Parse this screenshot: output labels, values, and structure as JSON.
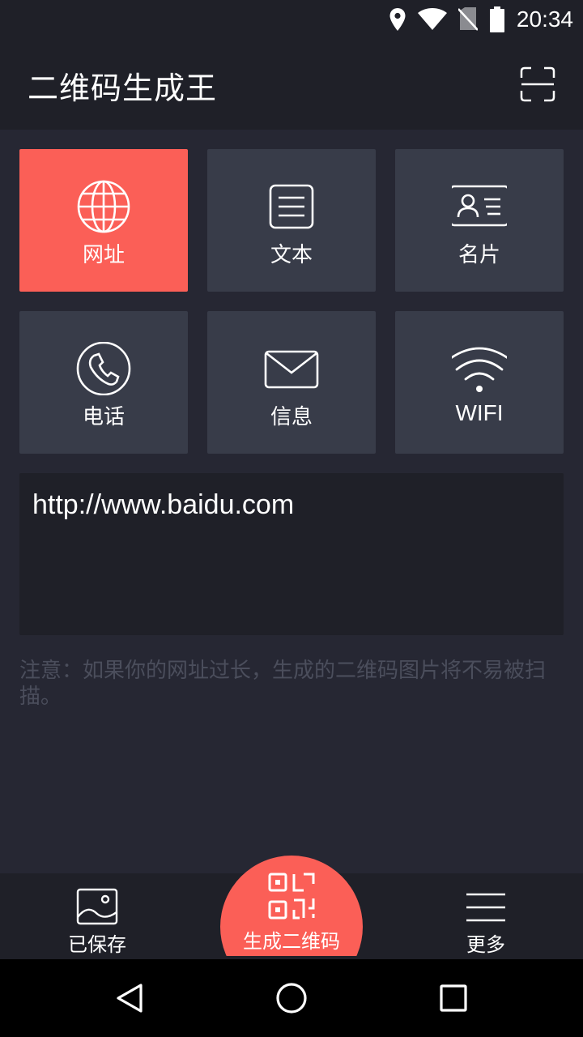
{
  "status": {
    "time": "20:34",
    "icons": [
      "location-icon",
      "wifi-icon",
      "no-sim-icon",
      "battery-icon"
    ]
  },
  "app": {
    "title": "二维码生成王",
    "scan_icon": "scan-icon"
  },
  "types": [
    {
      "label": "网址",
      "icon": "globe-icon",
      "active": true
    },
    {
      "label": "文本",
      "icon": "text-icon",
      "active": false
    },
    {
      "label": "名片",
      "icon": "contact-card-icon",
      "active": false
    },
    {
      "label": "电话",
      "icon": "phone-icon",
      "active": false
    },
    {
      "label": "信息",
      "icon": "mail-icon",
      "active": false
    },
    {
      "label": "WIFI",
      "icon": "wifi-icon",
      "active": false
    }
  ],
  "input": {
    "value": "http://www.baidu.com"
  },
  "note": "注意：如果你的网址过长，生成的二维码图片将不易被扫描。",
  "bottom_tabs": {
    "saved": "已保存",
    "generate": "生成二维码",
    "more": "更多"
  },
  "colors": {
    "accent": "#fb5f57",
    "background": "#262733",
    "tile": "#383c49",
    "bar": "#1f2028",
    "note": "#4b4e5c"
  }
}
